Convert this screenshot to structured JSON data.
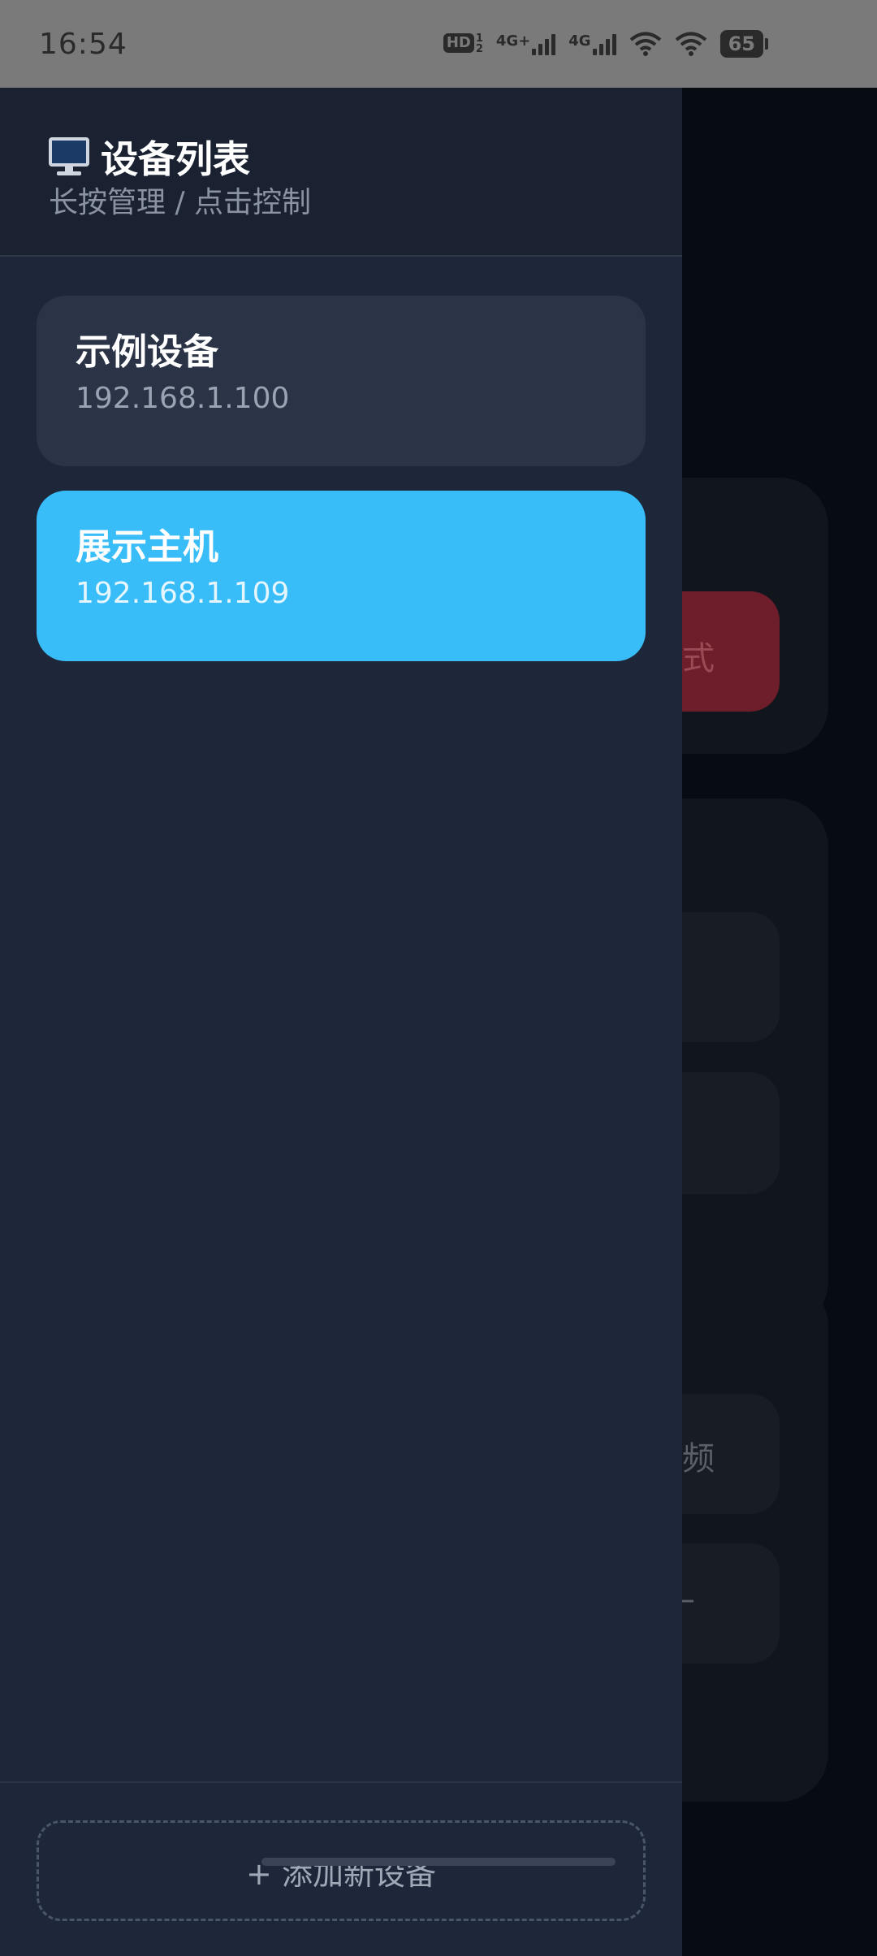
{
  "status_bar": {
    "time": "16:54",
    "hd_badge": "HD",
    "hd_sup": "1",
    "hd_sub": "2",
    "sim1_label": "4G+",
    "sim2_label": "4G",
    "battery": "65"
  },
  "drawer": {
    "title": "设备列表",
    "subtitle": "长按管理 / 点击控制",
    "devices": [
      {
        "name": "示例设备",
        "ip": "192.168.1.100",
        "active": false
      },
      {
        "name": "展示主机",
        "ip": "192.168.1.109",
        "active": true
      }
    ],
    "add_button_label": "+ 添加新设备"
  },
  "background_page": {
    "partial_texts": [
      "式",
      "频",
      "–"
    ]
  },
  "colors": {
    "drawer_bg": "#1e2739",
    "card_bg": "#2a3446",
    "active_card_bg": "#38bdf8",
    "status_bar_bg": "#7a7a7a"
  }
}
